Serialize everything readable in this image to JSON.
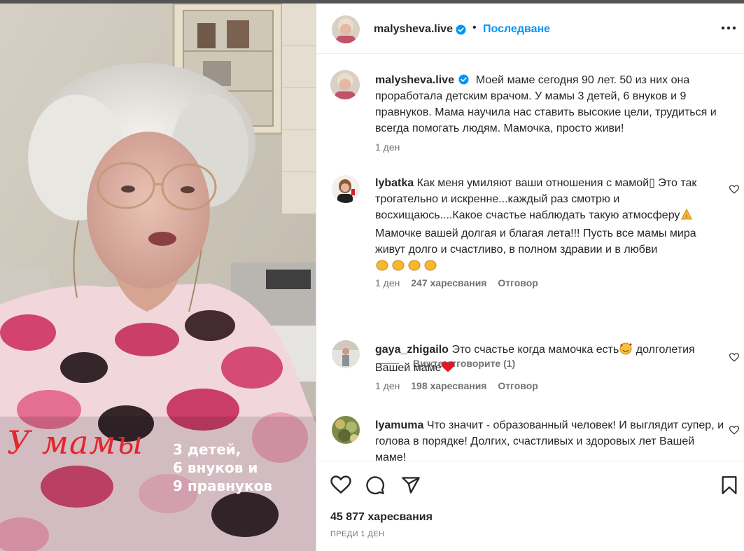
{
  "media": {
    "title": "У мамы",
    "lines": [
      "3 детей,",
      "6 внуков и",
      "9 правнуков"
    ]
  },
  "header": {
    "username": "malysheva.live",
    "separator": "•",
    "follow_label": "Последване"
  },
  "caption": {
    "username": "malysheva.live",
    "text": "Моей маме сегодня 90 лет. 50 из них она проработала детским врачом. У мамы 3 детей, 6 внуков и 9 правнуков. Мама научила нас ставить высокие цели, трудиться и всегда помогать людям. Мамочка, просто живи!",
    "time": "1 ден"
  },
  "comments": [
    {
      "username": "lybatka",
      "text": "Как меня умиляют ваши отношения с мамой▯ Это так трогательно и искренне...каждый раз смотрю и восхищаюсь....Какое счастье наблюдать такую атмосферу",
      "text_tail": "Мамочке вашей долгая и благая лета!!! Пусть все мамы мира живут долго и счастливо, в полном здравии и в любви",
      "time": "1 ден",
      "likes": "247 харесвания",
      "reply": "Отговор",
      "view_replies": "Вижте отговорите (1)"
    },
    {
      "username": "gaya_zhigailo",
      "text": "Это счастье когда мамочка есть",
      "text_tail": " долголетия Вашей маме",
      "time": "1 ден",
      "likes": "198 харесвания",
      "reply": "Отговор"
    },
    {
      "username": "lyamuma",
      "text": "Что значит - образованный человек! И выглядит супер, и голова в порядке! Долгих, счастливых и здоровых лет Вашей маме!"
    }
  ],
  "footer": {
    "likes": "45 877 харесвания",
    "time": "ПРЕДИ 1 ДЕН"
  },
  "icons": {
    "verified": "verified-badge-icon",
    "like": "heart-icon",
    "comment": "comment-icon",
    "share": "share-icon",
    "save": "bookmark-icon",
    "more": "more-options-icon"
  },
  "colors": {
    "accent": "#0095f6",
    "text": "#262626",
    "muted": "#737373",
    "title_red": "#e2262f"
  }
}
